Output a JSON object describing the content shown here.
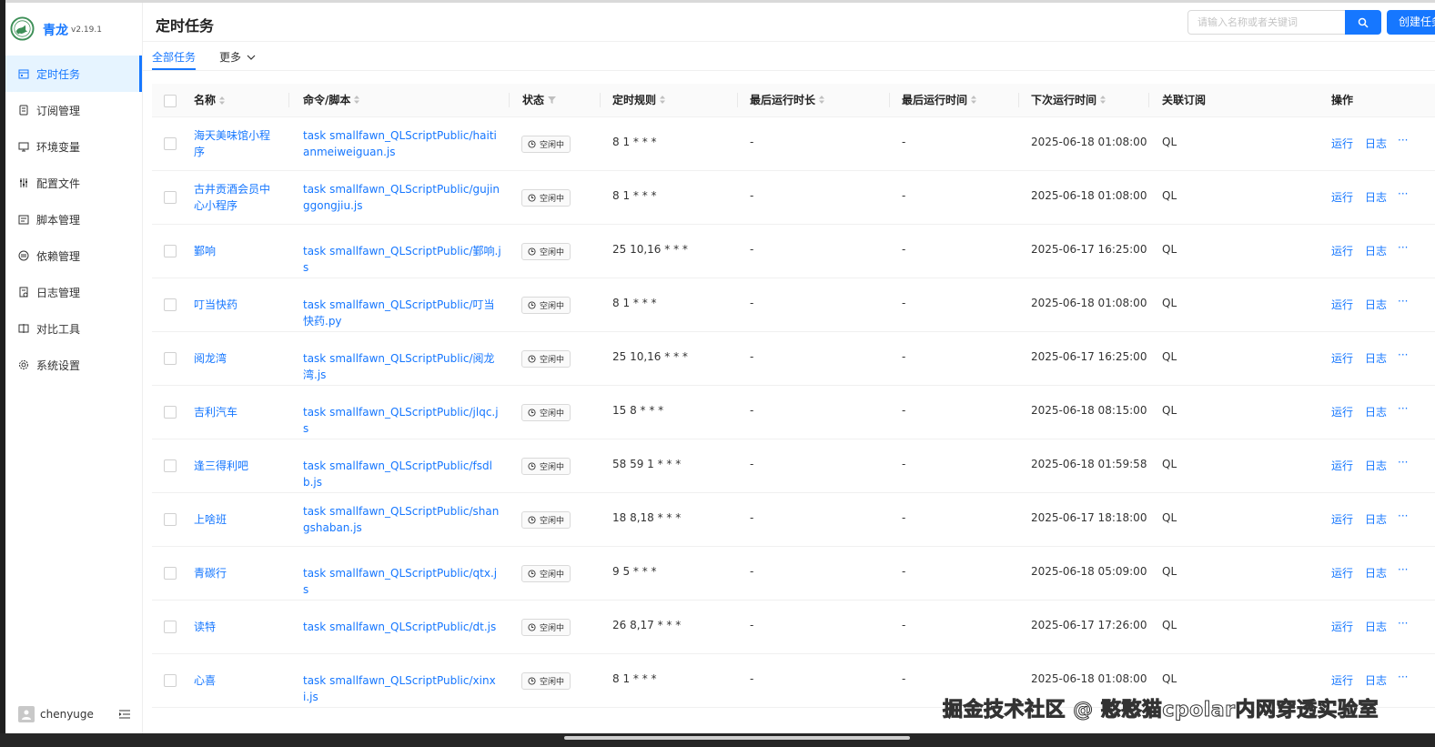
{
  "sidebar": {
    "brand": "青龙",
    "version": "v2.19.1",
    "menu": [
      {
        "label": "定时任务",
        "icon": "calendar-icon"
      },
      {
        "label": "订阅管理",
        "icon": "subscription-icon"
      },
      {
        "label": "环境变量",
        "icon": "monitor-icon"
      },
      {
        "label": "配置文件",
        "icon": "sliders-icon"
      },
      {
        "label": "脚本管理",
        "icon": "script-icon"
      },
      {
        "label": "依赖管理",
        "icon": "dependency-icon"
      },
      {
        "label": "日志管理",
        "icon": "log-icon"
      },
      {
        "label": "对比工具",
        "icon": "diff-icon"
      },
      {
        "label": "系统设置",
        "icon": "settings-icon"
      }
    ],
    "user": "chenyuge"
  },
  "header": {
    "title": "定时任务",
    "search_placeholder": "请输入名称或者关键词",
    "create_label": "创建任务"
  },
  "tabs": {
    "all": "全部任务",
    "more": "更多"
  },
  "table": {
    "columns": {
      "name": "名称",
      "command": "命令/脚本",
      "status": "状态",
      "schedule": "定时规则",
      "last_duration": "最后运行时长",
      "last_run": "最后运行时间",
      "next_run": "下次运行时间",
      "subscription": "关联订阅",
      "actions": "操作"
    },
    "status_label": "空闲中",
    "run_label": "运行",
    "log_label": "日志",
    "more_label": "···",
    "rows": [
      {
        "name": "海天美味馆小程序",
        "command": "task smallfawn_QLScriptPublic/haitianmeiweiguan.js",
        "schedule": "8 1 * * *",
        "last_duration": "-",
        "last_run": "-",
        "next_run": "2025-06-18 01:08:00",
        "subscription": "QL"
      },
      {
        "name": "古井贡酒会员中心小程序",
        "command": "task smallfawn_QLScriptPublic/gujinggongjiu.js",
        "schedule": "8 1 * * *",
        "last_duration": "-",
        "last_run": "-",
        "next_run": "2025-06-18 01:08:00",
        "subscription": "QL"
      },
      {
        "name": "鄞响",
        "command": "task smallfawn_QLScriptPublic/鄞响.js",
        "schedule": "25 10,16 * * *",
        "last_duration": "-",
        "last_run": "-",
        "next_run": "2025-06-17 16:25:00",
        "subscription": "QL"
      },
      {
        "name": "叮当快药",
        "command": "task smallfawn_QLScriptPublic/叮当快药.py",
        "schedule": "8 1 * * *",
        "last_duration": "-",
        "last_run": "-",
        "next_run": "2025-06-18 01:08:00",
        "subscription": "QL"
      },
      {
        "name": "阅龙湾",
        "command": "task smallfawn_QLScriptPublic/阅龙湾.js",
        "schedule": "25 10,16 * * *",
        "last_duration": "-",
        "last_run": "-",
        "next_run": "2025-06-17 16:25:00",
        "subscription": "QL"
      },
      {
        "name": "吉利汽车",
        "command": "task smallfawn_QLScriptPublic/jlqc.js",
        "schedule": "15 8 * * *",
        "last_duration": "-",
        "last_run": "-",
        "next_run": "2025-06-18 08:15:00",
        "subscription": "QL"
      },
      {
        "name": "逢三得利吧",
        "command": "task smallfawn_QLScriptPublic/fsdlb.js",
        "schedule": "58 59 1 * * *",
        "last_duration": "-",
        "last_run": "-",
        "next_run": "2025-06-18 01:59:58",
        "subscription": "QL"
      },
      {
        "name": "上啥班",
        "command": "task smallfawn_QLScriptPublic/shangshaban.js",
        "schedule": "18 8,18 * * *",
        "last_duration": "-",
        "last_run": "-",
        "next_run": "2025-06-17 18:18:00",
        "subscription": "QL"
      },
      {
        "name": "青碳行",
        "command": "task smallfawn_QLScriptPublic/qtx.js",
        "schedule": "9 5 * * *",
        "last_duration": "-",
        "last_run": "-",
        "next_run": "2025-06-18 05:09:00",
        "subscription": "QL"
      },
      {
        "name": "读特",
        "command": "task smallfawn_QLScriptPublic/dt.js",
        "schedule": "26 8,17 * * *",
        "last_duration": "-",
        "last_run": "-",
        "next_run": "2025-06-17 17:26:00",
        "subscription": "QL"
      },
      {
        "name": "心喜",
        "command": "task smallfawn_QLScriptPublic/xinxi.js",
        "schedule": "8 1 * * *",
        "last_duration": "-",
        "last_run": "-",
        "next_run": "2025-06-18 01:08:00",
        "subscription": "QL"
      }
    ]
  },
  "watermark": "掘金技术社区 @ 憨憨猫cpolar内网穿透实验室",
  "colors": {
    "primary": "#1677ff",
    "active_bg": "#e6f4ff"
  }
}
